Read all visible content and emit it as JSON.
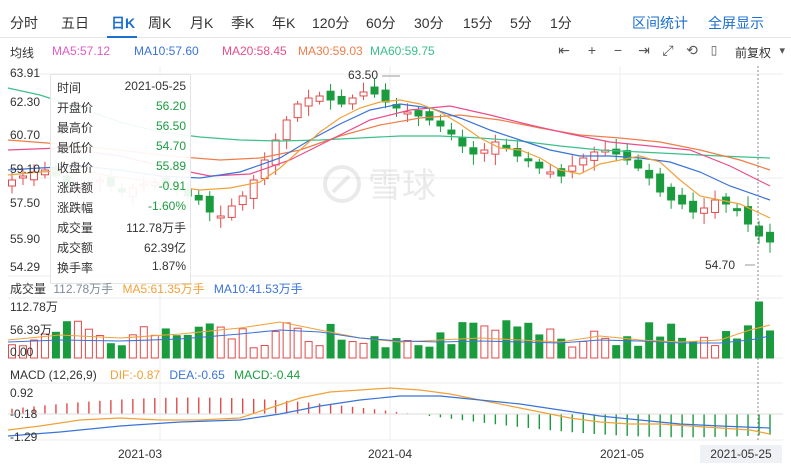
{
  "tabs": {
    "items": [
      "分时",
      "五日",
      "日K",
      "周K",
      "月K",
      "季K",
      "年K",
      "120分",
      "60分",
      "30分",
      "15分",
      "5分",
      "1分"
    ],
    "active": "日K",
    "right": [
      "区间统计",
      "全屏显示"
    ]
  },
  "ma_legend": {
    "label": "均线",
    "items": [
      {
        "text": "MA5:57.12",
        "color": "#e35ac6"
      },
      {
        "text": "MA10:57.60",
        "color": "#3a73d8"
      },
      {
        "text": "MA20:58.45",
        "color": "#e94d8a"
      },
      {
        "text": "MA30:59.03",
        "color": "#ef7d4a"
      },
      {
        "text": "MA60:59.75",
        "color": "#3cc08a"
      }
    ]
  },
  "toolbar": {
    "fuquan": "前复权"
  },
  "price_axis": [
    "63.91",
    "62.30",
    "60.70",
    "59.10",
    "57.50",
    "55.90",
    "54.29"
  ],
  "annotations": {
    "high": "63.50",
    "low": "54.70"
  },
  "info_box": [
    {
      "k": "时间",
      "v": "2021-05-25",
      "color": "#333333"
    },
    {
      "k": "开盘价",
      "v": "56.20",
      "color": "#1a9c3e"
    },
    {
      "k": "最高价",
      "v": "56.50",
      "color": "#1a9c3e"
    },
    {
      "k": "最低价",
      "v": "54.70",
      "color": "#1a9c3e"
    },
    {
      "k": "收盘价",
      "v": "55.89",
      "color": "#1a9c3e"
    },
    {
      "k": "涨跌额",
      "v": "-0.91",
      "color": "#1a9c3e"
    },
    {
      "k": "涨跌幅",
      "v": "-1.60%",
      "color": "#1a9c3e"
    },
    {
      "k": "成交量",
      "v": "112.78万手",
      "color": "#333333"
    },
    {
      "k": "成交额",
      "v": "62.39亿",
      "color": "#333333"
    },
    {
      "k": "换手率",
      "v": "1.87%",
      "color": "#333333"
    }
  ],
  "volume_legend": {
    "label": "成交量",
    "items": [
      {
        "text": "112.78万手",
        "color": "#7f8c99"
      },
      {
        "text": "MA5:61.35万手",
        "color": "#f0a23a"
      },
      {
        "text": "MA10:41.53万手",
        "color": "#3a73d8"
      }
    ],
    "axis": [
      "112.78万",
      "56.39万",
      "0.00"
    ]
  },
  "macd_legend": {
    "label": "MACD (12,26,9)",
    "items": [
      {
        "text": "DIF:-0.87",
        "color": "#f0a23a"
      },
      {
        "text": "DEA:-0.65",
        "color": "#3a73d8"
      },
      {
        "text": "MACD:-0.44",
        "color": "#1a9c3e"
      }
    ],
    "axis": [
      "0.92",
      "-0.18",
      "-1.29"
    ]
  },
  "dates": [
    "2021-03",
    "2021-04",
    "2021-05"
  ],
  "cursor_date": "2021-05-25",
  "colors": {
    "up": "#e24a4a",
    "down": "#1a9c3e",
    "accent": "#1a6fd0"
  },
  "watermark": "雪球"
}
